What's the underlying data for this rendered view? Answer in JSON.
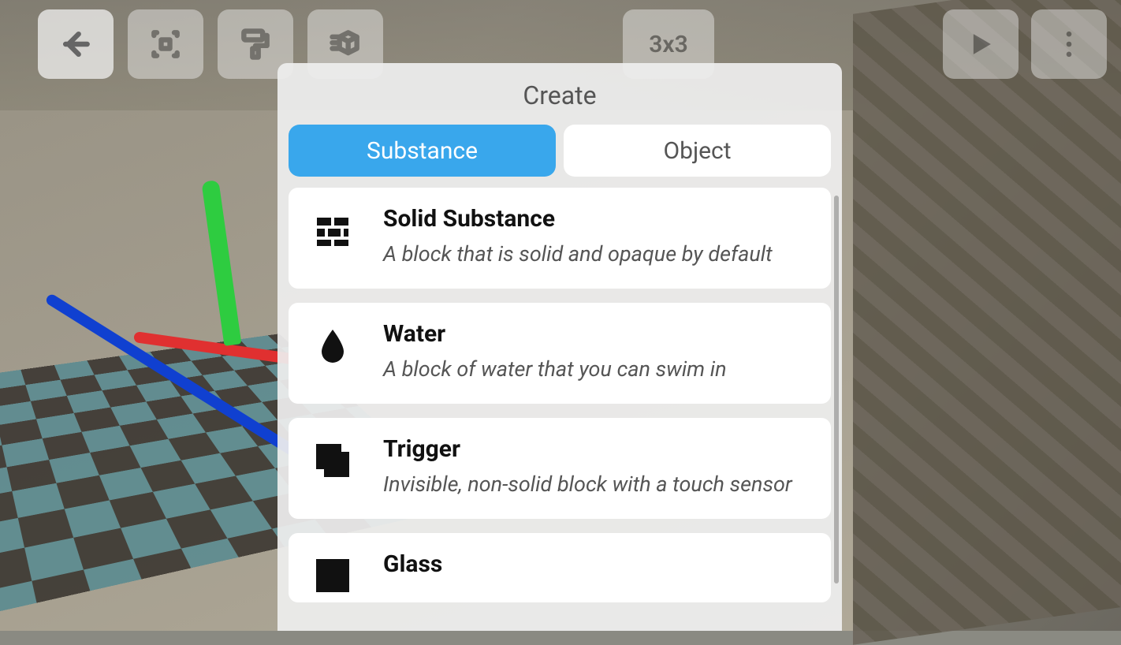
{
  "toolbar": {
    "back_label": "Back",
    "select_label": "Select",
    "paint_label": "Paint",
    "create_label": "Create",
    "grid_label": "3x3",
    "play_label": "Play",
    "menu_label": "Menu"
  },
  "modal": {
    "title": "Create",
    "tabs": {
      "substance": "Substance",
      "object": "Object",
      "active": "substance"
    },
    "items": [
      {
        "icon": "bricks-icon",
        "title": "Solid Substance",
        "desc": "A block that is solid and opaque by default"
      },
      {
        "icon": "drop-icon",
        "title": "Water",
        "desc": "A block of water that you can swim in"
      },
      {
        "icon": "overlap-icon",
        "title": "Trigger",
        "desc": "Invisible, non-solid block with a touch sensor"
      },
      {
        "icon": "glass-icon",
        "title": "Glass",
        "desc": ""
      }
    ]
  }
}
